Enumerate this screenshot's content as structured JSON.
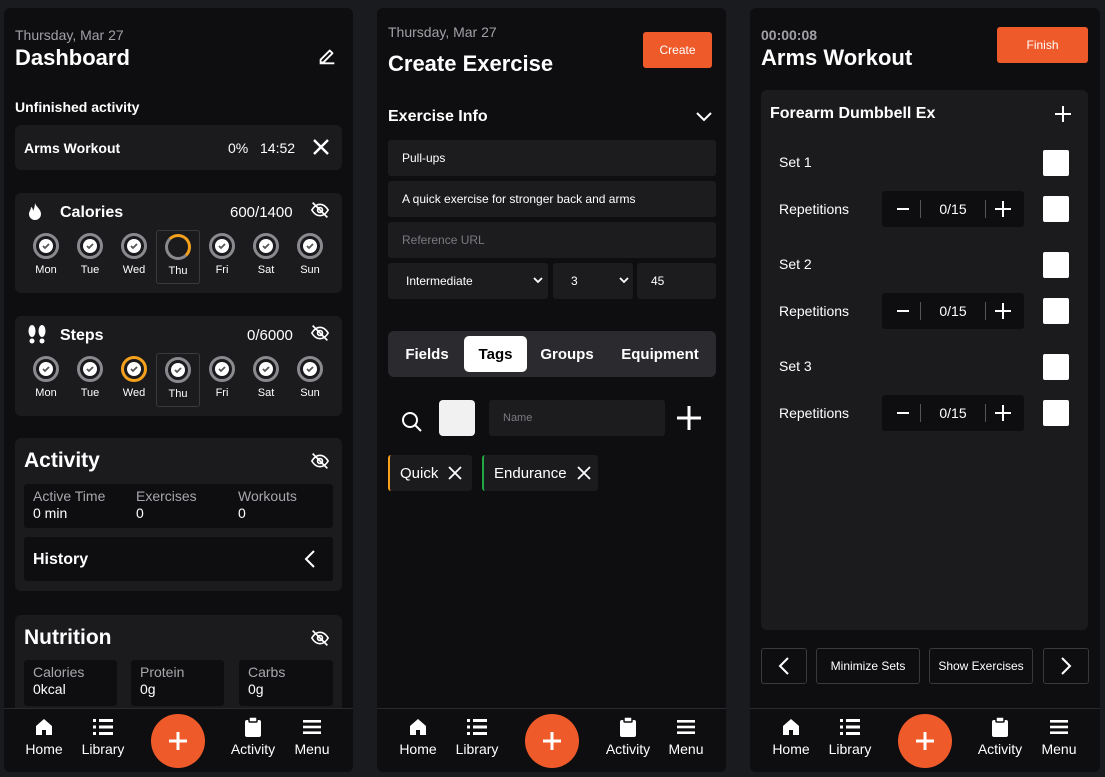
{
  "dashboard": {
    "date": "Thursday, Mar 27",
    "title": "Dashboard",
    "unfinished_heading": "Unfinished activity",
    "unfinished": {
      "name": "Arms Workout",
      "percent": "0%",
      "time": "14:52"
    },
    "calories": {
      "label": "Calories",
      "value": "600/1400"
    },
    "steps": {
      "label": "Steps",
      "value": "0/6000"
    },
    "days": [
      "Mon",
      "Tue",
      "Wed",
      "Thu",
      "Fri",
      "Sat",
      "Sun"
    ],
    "activity": {
      "title": "Activity",
      "stats": [
        {
          "label": "Active Time",
          "value": "0 min"
        },
        {
          "label": "Exercises",
          "value": "0"
        },
        {
          "label": "Workouts",
          "value": "0"
        }
      ],
      "history": "History"
    },
    "nutrition": {
      "title": "Nutrition",
      "stats": [
        {
          "label": "Calories",
          "value": "0kcal"
        },
        {
          "label": "Protein",
          "value": "0g"
        },
        {
          "label": "Carbs",
          "value": "0g"
        }
      ]
    }
  },
  "create": {
    "date": "Thursday, Mar 27",
    "title": "Create Exercise",
    "create_button": "Create",
    "section": "Exercise Info",
    "name_value": "Pull-ups",
    "description_value": "A quick exercise for stronger back and arms",
    "url_placeholder": "Reference URL",
    "difficulty": "Intermediate",
    "sets": "3",
    "duration": "45",
    "tabs": [
      "Fields",
      "Tags",
      "Groups",
      "Equipment"
    ],
    "tag_name_placeholder": "Name",
    "tags": [
      {
        "label": "Quick",
        "color": "#f6a11b"
      },
      {
        "label": "Endurance",
        "color": "#22a745"
      }
    ]
  },
  "workout": {
    "timer": "00:00:08",
    "title": "Arms Workout",
    "finish_button": "Finish",
    "exercise": "Forearm Dumbbell Ex",
    "sets": [
      {
        "label": "Set 1",
        "reps_label": "Repetitions",
        "reps": "0/15"
      },
      {
        "label": "Set 2",
        "reps_label": "Repetitions",
        "reps": "0/15"
      },
      {
        "label": "Set 3",
        "reps_label": "Repetitions",
        "reps": "0/15"
      }
    ],
    "minimize_button": "Minimize Sets",
    "show_button": "Show Exercises"
  },
  "nav": {
    "home": "Home",
    "library": "Library",
    "activity": "Activity",
    "menu": "Menu"
  },
  "colors": {
    "accent": "#ef5a2a",
    "ring_progress": "#f6a11b"
  }
}
